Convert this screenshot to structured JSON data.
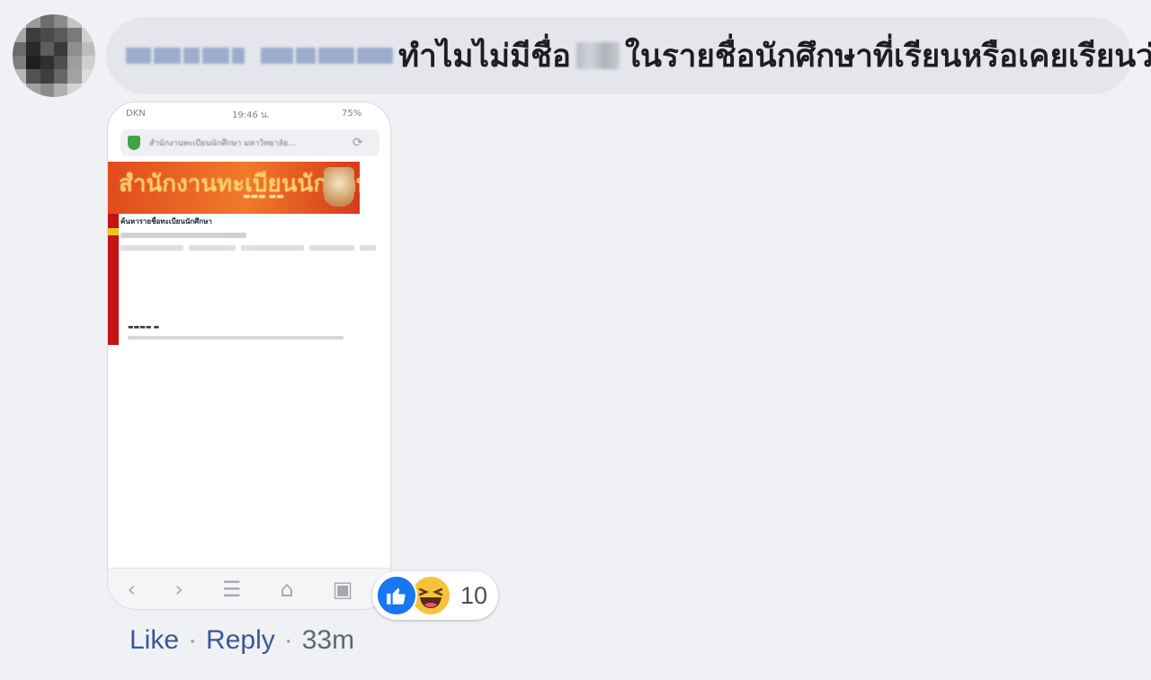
{
  "comment": {
    "text_part1": "ทำไมไม่มีชื่อ",
    "text_part2": "ในรายชื่อนักศึกษาที่เรียนหรือเคยเรียนว่ะ"
  },
  "attachment": {
    "status_carrier": "DKN",
    "status_time": "19:46 น.",
    "status_battery": "75%",
    "url_text": "สำนักงานทะเบียนนักศึกษา มหาวิทยาลัย...",
    "banner_title": "สำนักงานทะเบียนนักศึกษา",
    "page_heading": "ค้นหารายชื่อทะเบียนนักศึกษา",
    "nav_icons": [
      "chevron-left-icon",
      "chevron-right-icon",
      "menu-icon",
      "home-icon",
      "tabs-icon"
    ]
  },
  "reactions": {
    "types": [
      "like",
      "haha"
    ],
    "count": "10",
    "colors": {
      "like": "#1877f2",
      "haha": "#f7c33d"
    }
  },
  "actions": {
    "like_label": "Like",
    "separator": "·",
    "reply_label": "Reply",
    "time": "33m"
  }
}
